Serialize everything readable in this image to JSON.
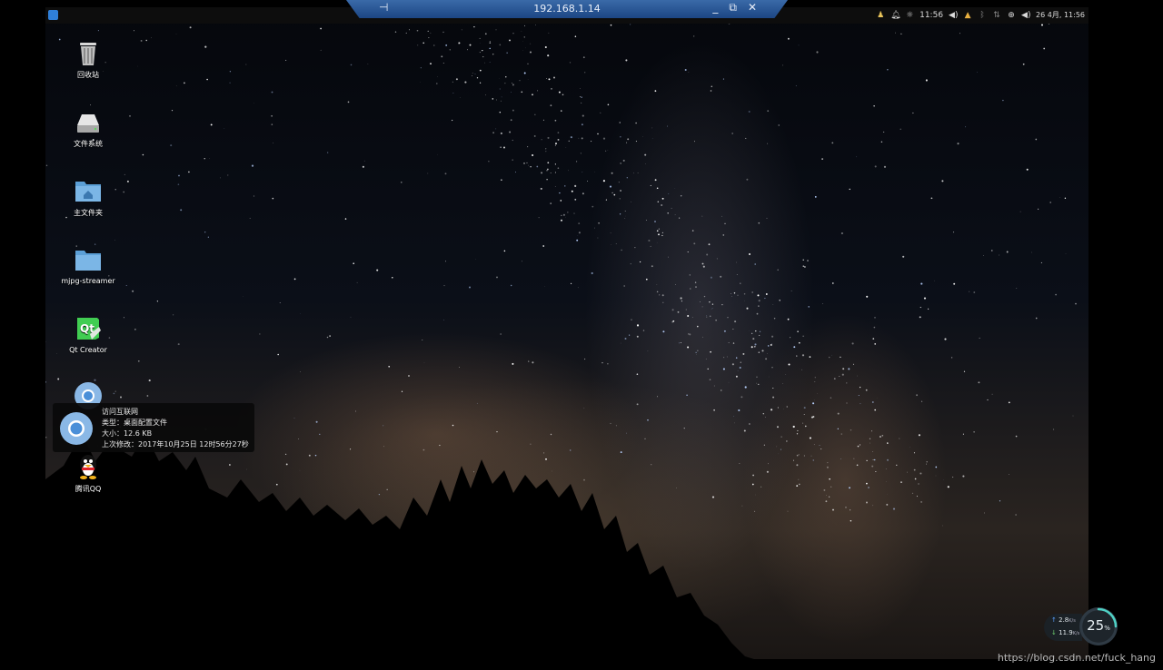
{
  "remote_bar": {
    "host": "192.168.1.14",
    "pin_glyph": "⊣",
    "minimize_glyph": "_",
    "restore_glyph": "⧉",
    "close_glyph": "✕"
  },
  "panel": {
    "time": "11:56",
    "date_time": "26 4月, 11:56",
    "tray_icons": [
      "user-icon",
      "bell-icon",
      "brightness-icon",
      "volume-icon",
      "input-method-icon",
      "bluetooth-icon",
      "network-icon",
      "update-icon",
      "volume-icon"
    ]
  },
  "desktop_icons": [
    {
      "name": "trash",
      "label": "回收站"
    },
    {
      "name": "file-system",
      "label": "文件系统"
    },
    {
      "name": "home-folder",
      "label": "主文件夹"
    },
    {
      "name": "mjpg-streamer-folder",
      "label": "mjpg-streamer"
    },
    {
      "name": "qt-creator",
      "label": "Qt Creator"
    },
    {
      "name": "chromium",
      "label": "访问互联网"
    },
    {
      "name": "qq",
      "label": "腾讯QQ"
    }
  ],
  "tooltip": {
    "title": "访问互联网",
    "type": "类型：桌面配置文件",
    "size": "大小：12.6 KB",
    "modified": "上次修改：2017年10月25日 12时56分27秒"
  },
  "net_monitor": {
    "upload": "2.8",
    "upload_unit": "K/s",
    "download": "11.9",
    "download_unit": "K/s",
    "usage_percent": 25,
    "usage_text": "25",
    "usage_symbol": "%"
  },
  "watermark": "https://blog.csdn.net/fuck_hang",
  "colors": {
    "panel": "#0d0d0d",
    "remote_bar": "#2a5a98",
    "accent": "#2f7fd8"
  }
}
